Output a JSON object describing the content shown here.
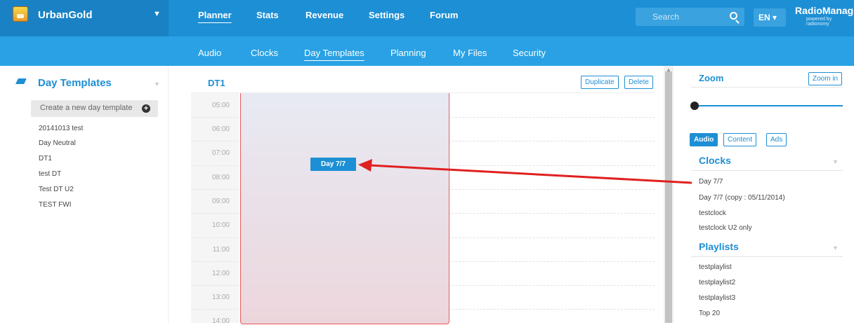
{
  "header": {
    "station_name": "UrbanGold",
    "nav": [
      "Planner",
      "Stats",
      "Revenue",
      "Settings",
      "Forum"
    ],
    "active_nav": "Planner",
    "search_placeholder": "Search",
    "language": "EN ▾",
    "brand": "RadioManager",
    "brand_sub": "powered by radionomy"
  },
  "subnav": {
    "items": [
      "Audio",
      "Clocks",
      "Day Templates",
      "Planning",
      "My Files",
      "Security"
    ],
    "active": "Day Templates"
  },
  "left_panel": {
    "title": "Day Templates",
    "create_button": "Create a new day template",
    "templates": [
      "20141013 test",
      "Day Neutral",
      "DT1",
      "test DT",
      "Test DT U2",
      "TEST FWI"
    ]
  },
  "main": {
    "title": "DT1",
    "duplicate_label": "Duplicate",
    "delete_label": "Delete",
    "times": [
      "05:00",
      "06:00",
      "07:00",
      "08:00",
      "09:00",
      "10:00",
      "11:00",
      "12:00",
      "13:00",
      "14:00"
    ],
    "block_label": "Day 7/7"
  },
  "right_panel": {
    "zoom_title": "Zoom",
    "zoom_in_label": "Zoom in",
    "zoom_level": 0,
    "tabs": [
      "Audio",
      "Content",
      "Ads"
    ],
    "active_tab": "Audio",
    "clocks_title": "Clocks",
    "clocks": [
      "Day 7/7",
      "Day 7/7 (copy : 05/11/2014)",
      "testclock",
      "testclock U2 only"
    ],
    "playlists_title": "Playlists",
    "playlists": [
      "testplaylist",
      "testplaylist2",
      "testplaylist3",
      "Top 20"
    ]
  },
  "colors": {
    "primary": "#1d8fd4",
    "subnav_bg": "#29a1e4",
    "arrow": "#e02020"
  }
}
